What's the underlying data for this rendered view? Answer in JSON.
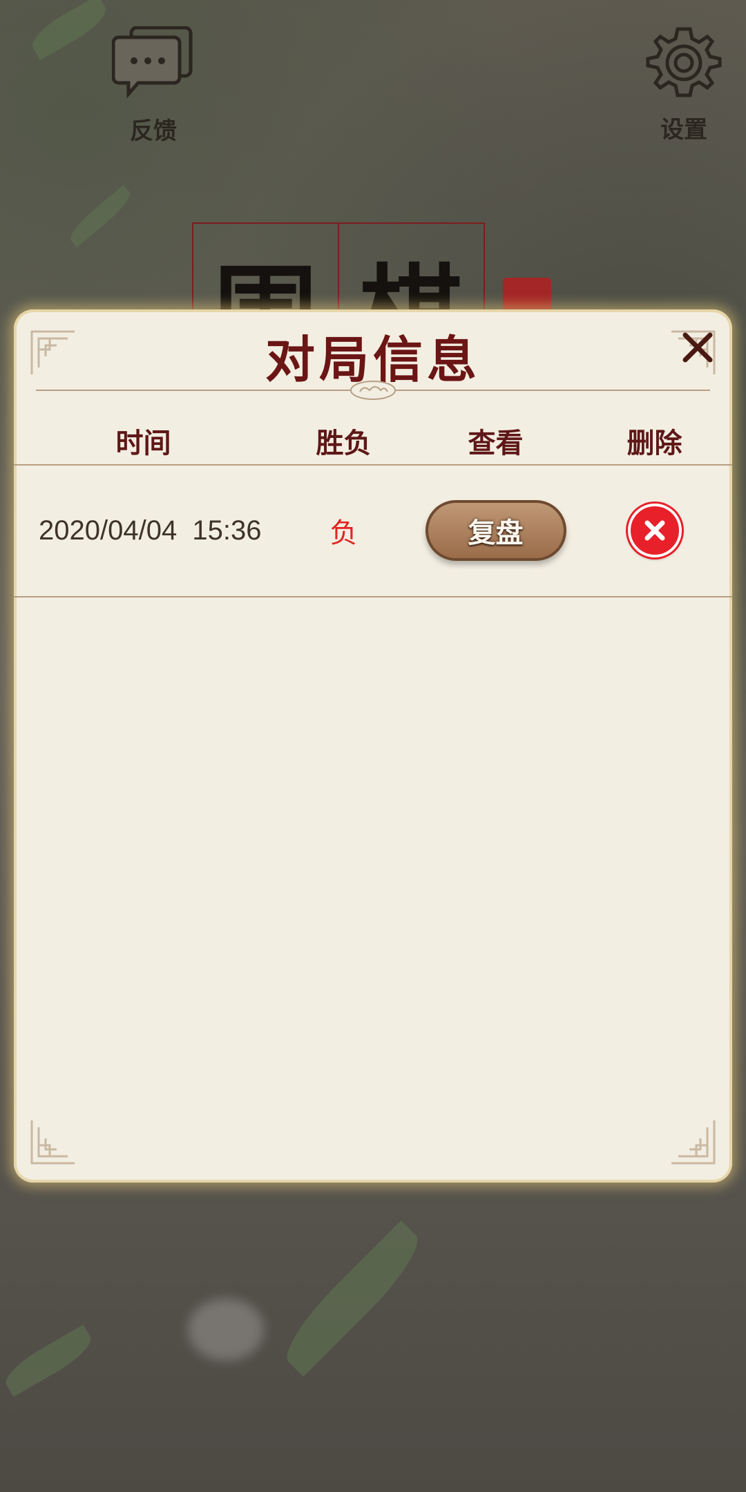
{
  "background": {
    "feedback_label": "反馈",
    "settings_label": "设置",
    "title_chars": [
      "围",
      "棋"
    ]
  },
  "dialog": {
    "title": "对局信息",
    "columns": [
      "时间",
      "胜负",
      "查看",
      "删除"
    ],
    "rows": [
      {
        "time": "2020/04/04  15:36",
        "result": "负",
        "review_label": "复盘"
      }
    ]
  },
  "colors": {
    "title": "#6b1515",
    "result_loss": "#e2231f",
    "delete_button": "#e8202a",
    "panel": "#f3eee2"
  }
}
